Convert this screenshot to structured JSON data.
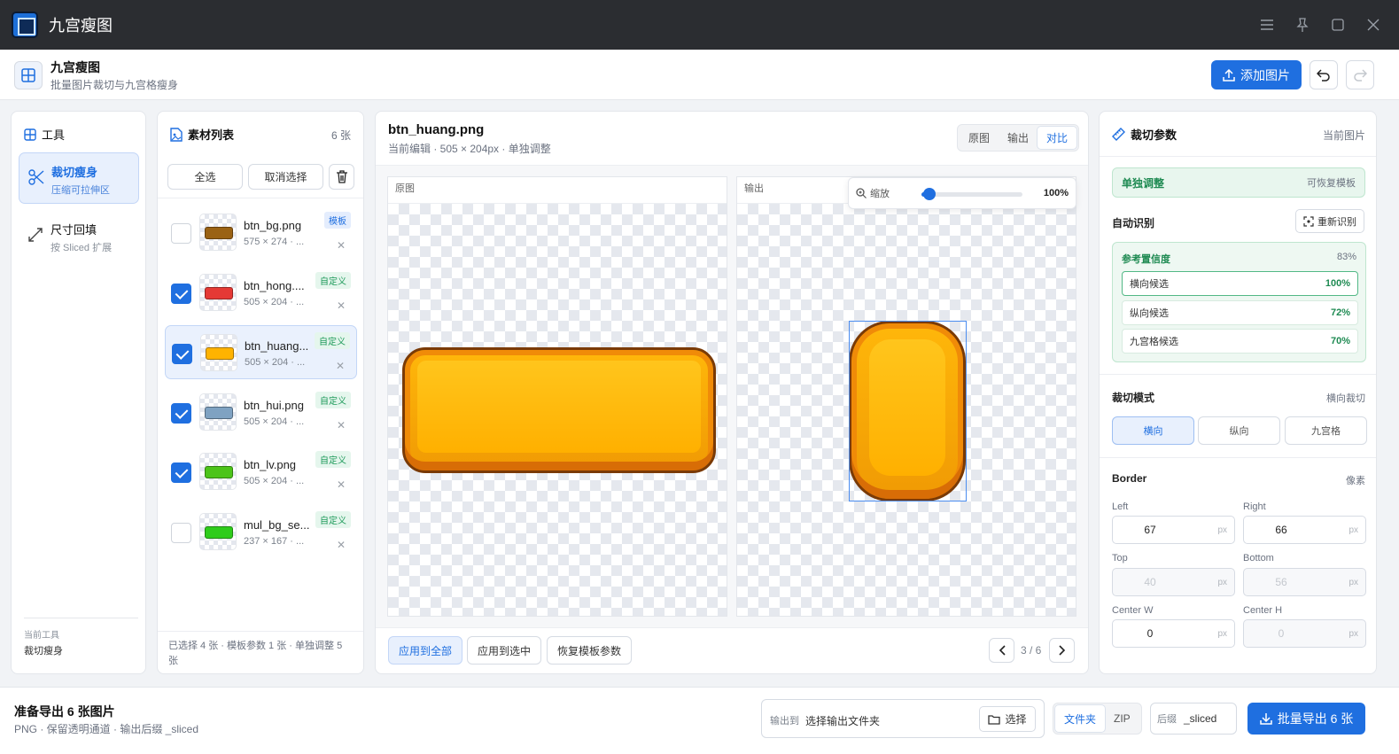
{
  "window": {
    "title": "九宫瘦图"
  },
  "header": {
    "title": "九宫瘦图",
    "subtitle": "批量图片裁切与九宫格瘦身",
    "add_label": "添加图片"
  },
  "tools": {
    "title": "工具",
    "items": [
      {
        "title": "裁切瘦身",
        "sub": "压缩可拉伸区"
      },
      {
        "title": "尺寸回填",
        "sub": "按 Sliced 扩展"
      }
    ],
    "footer_label": "当前工具",
    "footer_value": "裁切瘦身"
  },
  "assets": {
    "title": "素材列表",
    "count": "6 张",
    "select_all": "全选",
    "deselect": "取消选择",
    "items": [
      {
        "name": "btn_bg.png",
        "size": "575 × 274 · ...",
        "tag": "模板",
        "checked": false,
        "color": "#9a6214"
      },
      {
        "name": "btn_hong....",
        "size": "505 × 204 · ...",
        "tag": "自定义",
        "checked": true,
        "color": "#e53935"
      },
      {
        "name": "btn_huang...",
        "size": "505 × 204 · ...",
        "tag": "自定义",
        "checked": true,
        "color": "#ffb300"
      },
      {
        "name": "btn_hui.png",
        "size": "505 × 204 · ...",
        "tag": "自定义",
        "checked": true,
        "color": "#7fa2c2"
      },
      {
        "name": "btn_lv.png",
        "size": "505 × 204 · ...",
        "tag": "自定义",
        "checked": true,
        "color": "#4cc41a"
      },
      {
        "name": "mul_bg_se...",
        "size": "237 × 167 · ...",
        "tag": "自定义",
        "checked": false,
        "color": "#2ecc1b"
      }
    ],
    "footer": "已选择 4 张 · 模板参数 1 张 · 单独调整 5 张"
  },
  "editor": {
    "file": "btn_huang.png",
    "meta": "当前编辑 · 505 × 204px · 单独调整",
    "views": [
      "原图",
      "输出",
      "对比"
    ],
    "pane_source": "原图",
    "pane_output": "输出",
    "zoom_label": "缩放",
    "zoom_value": "100%",
    "zoom_fraction": 0.08,
    "apply_all": "应用到全部",
    "apply_selected": "应用到选中",
    "restore": "恢复模板参数",
    "page": "3 / 6"
  },
  "params": {
    "title": "裁切参数",
    "scope": "当前图片",
    "solo_title": "单独调整",
    "solo_hint": "可恢复模板",
    "auto_label": "自动识别",
    "redetect": "重新识别",
    "conf_title": "参考置信度",
    "conf_pct": "83%",
    "candidates": [
      {
        "label": "横向候选",
        "value": "100%"
      },
      {
        "label": "纵向候选",
        "value": "72%"
      },
      {
        "label": "九宫格候选",
        "value": "70%"
      }
    ],
    "mode_label": "裁切模式",
    "mode_current": "横向裁切",
    "modes": [
      "横向",
      "纵向",
      "九宫格"
    ],
    "border_label": "Border",
    "unit_label": "像素",
    "fields": {
      "left": {
        "label": "Left",
        "value": "67"
      },
      "right": {
        "label": "Right",
        "value": "66"
      },
      "top": {
        "label": "Top",
        "value": "40"
      },
      "bottom": {
        "label": "Bottom",
        "value": "56"
      },
      "center_w": {
        "label": "Center W",
        "value": "0"
      },
      "center_h": {
        "label": "Center H",
        "value": "0"
      }
    },
    "unit": "px"
  },
  "export": {
    "title": "准备导出 6 张图片",
    "sub": "PNG · 保留透明通道 · 输出后缀 _sliced",
    "out_label": "输出到",
    "out_path": "选择输出文件夹",
    "choose": "选择",
    "formats": [
      "文件夹",
      "ZIP"
    ],
    "suffix_label": "后缀",
    "suffix_value": "_sliced",
    "export_label": "批量导出 6 张"
  }
}
